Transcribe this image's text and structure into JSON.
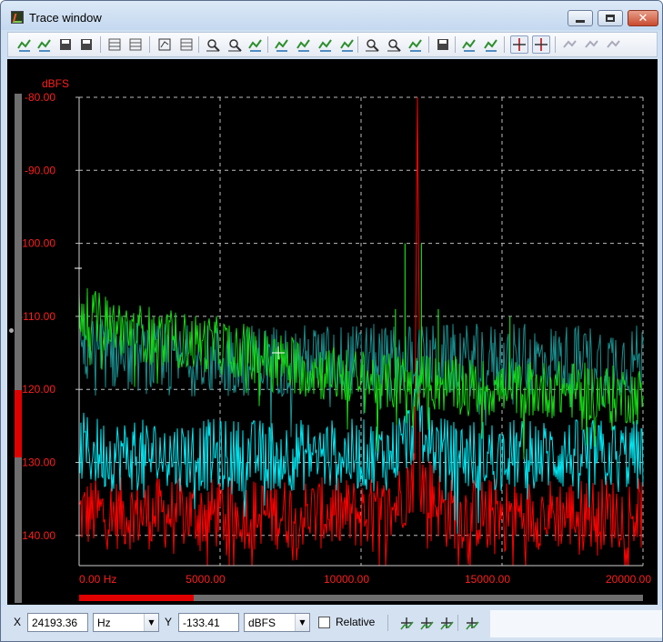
{
  "window": {
    "title": "Trace window",
    "controls": {
      "minimize_icon": "minimize-icon",
      "maximize_icon": "maximize-icon",
      "close_icon": "close-icon"
    }
  },
  "toolbar": {
    "buttons": [
      "add-trace-icon",
      "remove-trace-icon",
      "save-trace-icon",
      "copy-trace-icon",
      "trace-color-icon",
      "trace-properties-icon",
      "edit-icon",
      "table-icon",
      "zoom-in-icon",
      "zoom-out-icon",
      "autoscale-icon",
      "trace-shift-1-icon",
      "trace-shift-2-icon",
      "trace-shift-3-icon",
      "trace-shift-4-icon",
      "zoom-x-icon",
      "zoom-y-icon",
      "fit-icon",
      "print-icon",
      "peak-marker-icon",
      "valley-marker-icon",
      "cursor-mode-icon",
      "cross-cursor-icon",
      "disabled-1-icon",
      "disabled-2-icon",
      "disabled-3-icon"
    ],
    "active_buttons": [
      "cursor-mode-icon",
      "cross-cursor-icon"
    ]
  },
  "plot": {
    "y_unit": "dBFS",
    "y_ticks": [
      "-80.00",
      "-90.00",
      "-100.00",
      "-110.00",
      "-120.00",
      "-130.00",
      "-140.00"
    ],
    "x_ticks": [
      "0.00 Hz",
      "5000.00",
      "10000.00",
      "15000.00",
      "20000.00"
    ],
    "colors": {
      "background": "#000000",
      "grid": "#bdbdbd",
      "labels": "#ff1e1e"
    },
    "cursor": {
      "x": 24193.36,
      "y": -133.41
    }
  },
  "chart_data": {
    "type": "line",
    "xlabel": "",
    "ylabel": "dBFS",
    "xlim": [
      0,
      20000
    ],
    "ylim": [
      -145,
      -80
    ],
    "grid": true,
    "series": [
      {
        "color": "#16d916",
        "x": [
          0,
          200,
          1000,
          2000,
          3000,
          5000,
          7000,
          9000,
          11000,
          12000,
          15000,
          17000,
          20000
        ],
        "values": [
          -108,
          -110,
          -111,
          -112,
          -113,
          -114,
          -116,
          -118,
          -119,
          -119,
          -120,
          -120,
          -121
        ]
      },
      {
        "color": "#1a8c8c",
        "x": [
          0,
          1000,
          3000,
          5000,
          7000,
          9000,
          11000,
          12000,
          15000,
          17000,
          20000
        ],
        "values": [
          -114,
          -115,
          -116,
          -116,
          -116,
          -116,
          -116,
          -116,
          -116,
          -116,
          -116
        ]
      },
      {
        "color": "#00e5f0",
        "x": [
          0,
          1000,
          3000,
          5000,
          7000,
          9000,
          11000,
          11800,
          12000,
          12200,
          13000,
          15000,
          20000
        ],
        "values": [
          -128,
          -129,
          -129,
          -129,
          -129,
          -129,
          -129,
          -126,
          -121,
          -126,
          -129,
          -129,
          -129
        ]
      },
      {
        "color": "#ff0000",
        "x": [
          0,
          2000,
          5000,
          8000,
          11000,
          11900,
          12000,
          12100,
          13000,
          16000,
          20000
        ],
        "values": [
          -137,
          -137,
          -137,
          -137,
          -137,
          -132,
          -80,
          -132,
          -137,
          -137,
          -137
        ]
      }
    ],
    "spikes": [
      {
        "series": "#16d916",
        "x": 11560,
        "value": -100
      },
      {
        "series": "#16d916",
        "x": 12140,
        "value": -100
      },
      {
        "series": "#16d916",
        "x": 11220,
        "value": -109
      },
      {
        "series": "#16d916",
        "x": 12740,
        "value": -109
      },
      {
        "series": "#16d916",
        "x": 15280,
        "value": -110
      },
      {
        "series": "#ff0000",
        "x": 12000,
        "value": -80
      }
    ]
  },
  "status": {
    "x_label": "X",
    "x_value": "24193.36",
    "x_unit": "Hz",
    "y_label": "Y",
    "y_value": "-133.41",
    "y_unit": "dBFS",
    "relative_label": "Relative",
    "relative_checked": false,
    "tools": [
      "marker-add-icon",
      "marker-next-icon",
      "marker-peak-icon",
      "marker-settings-icon"
    ]
  }
}
